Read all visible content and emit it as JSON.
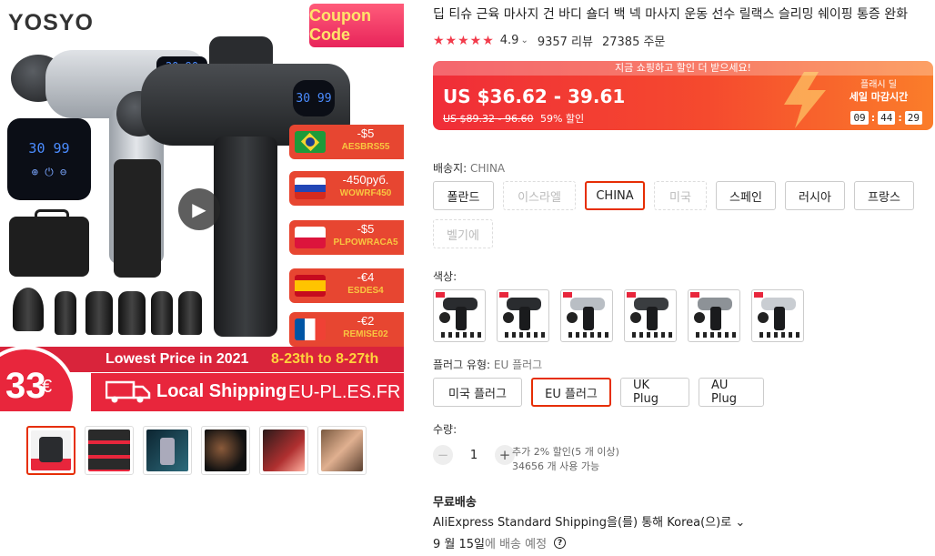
{
  "image": {
    "brand": "YOSYO",
    "coupon_badge": "Coupon Code",
    "screen_small": "30 99",
    "screen_top": "30 99",
    "screen_mid": "20 90",
    "play_icon": "play-icon",
    "flags": [
      {
        "amount": "-$5",
        "code": "AESBRS55"
      },
      {
        "amount": "-450руб.",
        "code": "WOWRF450"
      },
      {
        "amount": "-$5",
        "code": "PLPOWRACA5"
      },
      {
        "amount": "-€4",
        "code": "ESDES4"
      },
      {
        "amount": "-€2",
        "code": "REMISE02"
      }
    ],
    "promo_year": "Lowest Price in 2021",
    "promo_dates": "8-23th to 8-27th",
    "price_num": "33",
    "price_cur": "€",
    "ship_local": "Local Shipping",
    "ship_countries": "EU-PL.ES.FR"
  },
  "title": "딥 티슈 근육 마사지 건 바디 숄더 백 넥 마사지 운동 선수 릴랙스 슬리밍 쉐이핑 통증 완화",
  "rating": {
    "stars": "★★★★★",
    "score": "4.9",
    "reviews": "9357 리뷰",
    "orders": "27385 주문"
  },
  "banner": {
    "top_text": "지금 쇼핑하고 할인 더 받으세요!",
    "price": "US $36.62 - 39.61",
    "old_price": "US $89.32 - 96.60",
    "discount": "59% 할인",
    "flash_line1": "플래시 딜",
    "flash_line2": "세일 마감시간",
    "timer": {
      "h": "09",
      "m": "44",
      "s": "29"
    },
    "colors": {
      "start": "#f02d38",
      "end": "#fb7d2a"
    }
  },
  "ship_from": {
    "label": "배송지:",
    "selected": "CHINA",
    "options": [
      {
        "label": "폴란드",
        "state": "normal"
      },
      {
        "label": "이스라엘",
        "state": "disabled"
      },
      {
        "label": "CHINA",
        "state": "selected"
      },
      {
        "label": "미국",
        "state": "disabled"
      },
      {
        "label": "스페인",
        "state": "normal"
      },
      {
        "label": "러시아",
        "state": "normal"
      },
      {
        "label": "프랑스",
        "state": "normal"
      },
      {
        "label": "벨기에",
        "state": "disabled"
      }
    ]
  },
  "color": {
    "label": "색상:",
    "swatches": [
      {
        "name": "black-1",
        "head": "#2a2c2f",
        "grip": "#1a1b1d"
      },
      {
        "name": "black-2",
        "head": "#2a2c2f",
        "grip": "#1a1b1d"
      },
      {
        "name": "silver-1",
        "head": "#b9bec4",
        "grip": "#1a1b1d"
      },
      {
        "name": "black-3",
        "head": "#3a3d40",
        "grip": "#1a1b1d"
      },
      {
        "name": "gray-1",
        "head": "#8d9297",
        "grip": "#1a1b1d"
      },
      {
        "name": "silver-2",
        "head": "#c9cdd2",
        "grip": "#1a1b1d"
      }
    ]
  },
  "plug": {
    "label": "플러그 유형:",
    "selected": "EU 플러그",
    "options": [
      {
        "label": "미국 플러그",
        "state": "normal"
      },
      {
        "label": "EU 플러그",
        "state": "selected"
      },
      {
        "label": "UK Plug",
        "state": "normal"
      },
      {
        "label": "AU Plug",
        "state": "normal"
      }
    ]
  },
  "quantity": {
    "label": "수량:",
    "value": "1",
    "minus": "−",
    "plus": "+",
    "note1": "추가 2% 할인(5 개 이상)",
    "note2": "34656 개 사용 가능"
  },
  "shipping": {
    "title": "무료배송",
    "method": "AliExpress Standard Shipping을(를) 통해 Korea(으)로",
    "chevron": "⌄",
    "date": "9 월 15일",
    "date_suffix": "에 배송 예정",
    "help": "?"
  },
  "accent": "#e62e04"
}
